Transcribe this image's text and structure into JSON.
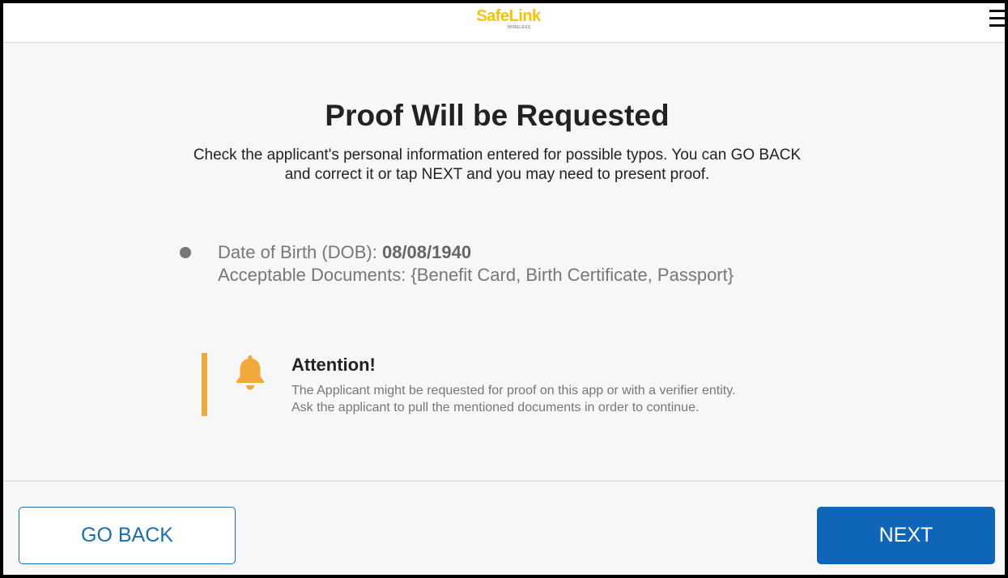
{
  "header": {
    "logo_text": "SafeLink",
    "logo_subtext": "WIRELESS",
    "brand_color": "#f5c400",
    "menu_icon": "hamburger-menu-icon"
  },
  "main": {
    "title": "Proof Will be Requested",
    "description": "Check the applicant's personal information entered for possible typos. You can GO BACK and correct it or tap NEXT and you may need to present proof.",
    "items": [
      {
        "label": "Date of Birth (DOB): ",
        "value": "08/08/1940",
        "documents": "Acceptable Documents: {Benefit Card, Birth Certificate, Passport}"
      }
    ]
  },
  "alert": {
    "icon": "bell-icon",
    "title": "Attention!",
    "line1": "The Applicant might be requested for proof on this app or with a verifier entity.",
    "line2": "Ask the applicant to pull the mentioned documents in order to continue.",
    "accent_color": "#f0a93b"
  },
  "footer": {
    "back_label": "GO BACK",
    "next_label": "NEXT",
    "primary_color": "#0f66b8"
  }
}
